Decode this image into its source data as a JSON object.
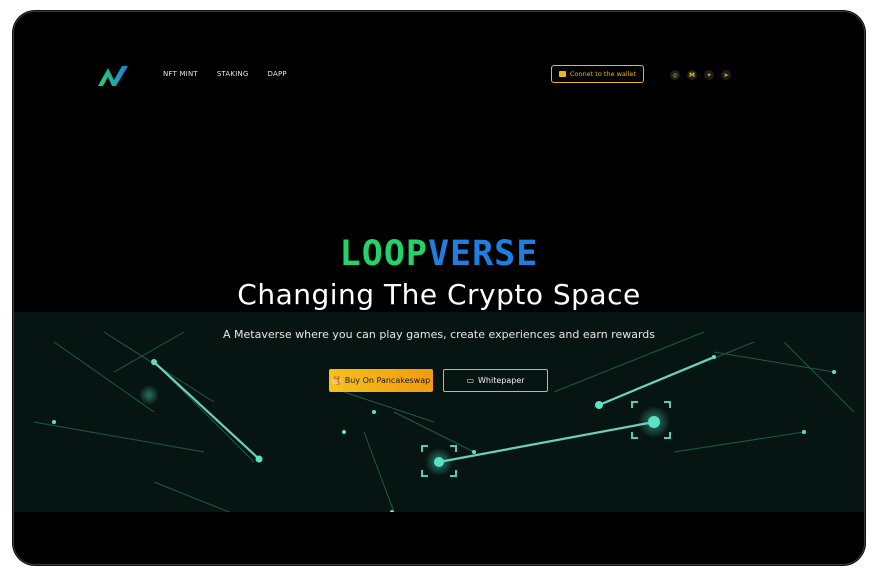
{
  "nav": {
    "items": [
      {
        "label": "NFT MINT"
      },
      {
        "label": "STAKING"
      },
      {
        "label": "DAPP"
      }
    ]
  },
  "header": {
    "connect_label": "Connet to the wallet",
    "socials": [
      {
        "icon": "instagram-icon",
        "glyph": "◎"
      },
      {
        "icon": "medium-icon",
        "glyph": "M"
      },
      {
        "icon": "twitter-icon",
        "glyph": "✦"
      },
      {
        "icon": "telegram-icon",
        "glyph": "➤"
      }
    ]
  },
  "hero": {
    "title_part1": "LOOP",
    "title_part2": "VERSE",
    "subtitle": "Changing The Crypto Space",
    "tagline": "A Metaverse where you can play games, create experiences and earn rewards",
    "buy_label": "Buy On Pancakeswap",
    "whitepaper_label": "Whitepaper"
  },
  "colors": {
    "accent": "#f3b512",
    "green": "#22d36a",
    "blue": "#1f7fe0",
    "background": "#000000"
  }
}
